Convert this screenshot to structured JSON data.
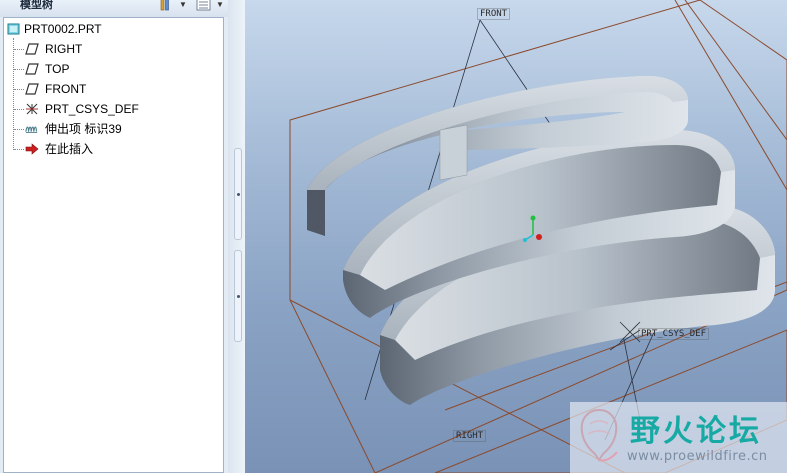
{
  "panel": {
    "title": "模型树"
  },
  "tree": {
    "root": "PRT0002.PRT",
    "items": [
      {
        "label": "RIGHT",
        "icon": "datum-plane-icon"
      },
      {
        "label": "TOP",
        "icon": "datum-plane-icon"
      },
      {
        "label": "FRONT",
        "icon": "datum-plane-icon"
      },
      {
        "label": "PRT_CSYS_DEF",
        "icon": "coordinate-system-icon"
      },
      {
        "label": "伸出项 标识39",
        "icon": "helical-protrusion-icon"
      },
      {
        "label": "在此插入",
        "icon": "insert-here-arrow-icon"
      }
    ]
  },
  "viewport": {
    "datum_front": "FRONT",
    "datum_right": "RIGHT",
    "datum_csys": "PRT_CSYS_DEF"
  },
  "watermark": {
    "title": "野火论坛",
    "url": "www.proewildfire.cn"
  },
  "colors": {
    "datum_plane": "#8b4a2c",
    "spring_surface": "#b8c2cb",
    "viewport_top": "#c7d8ec",
    "viewport_bottom": "#7992b6",
    "watermark_text": "#17a9a4"
  }
}
